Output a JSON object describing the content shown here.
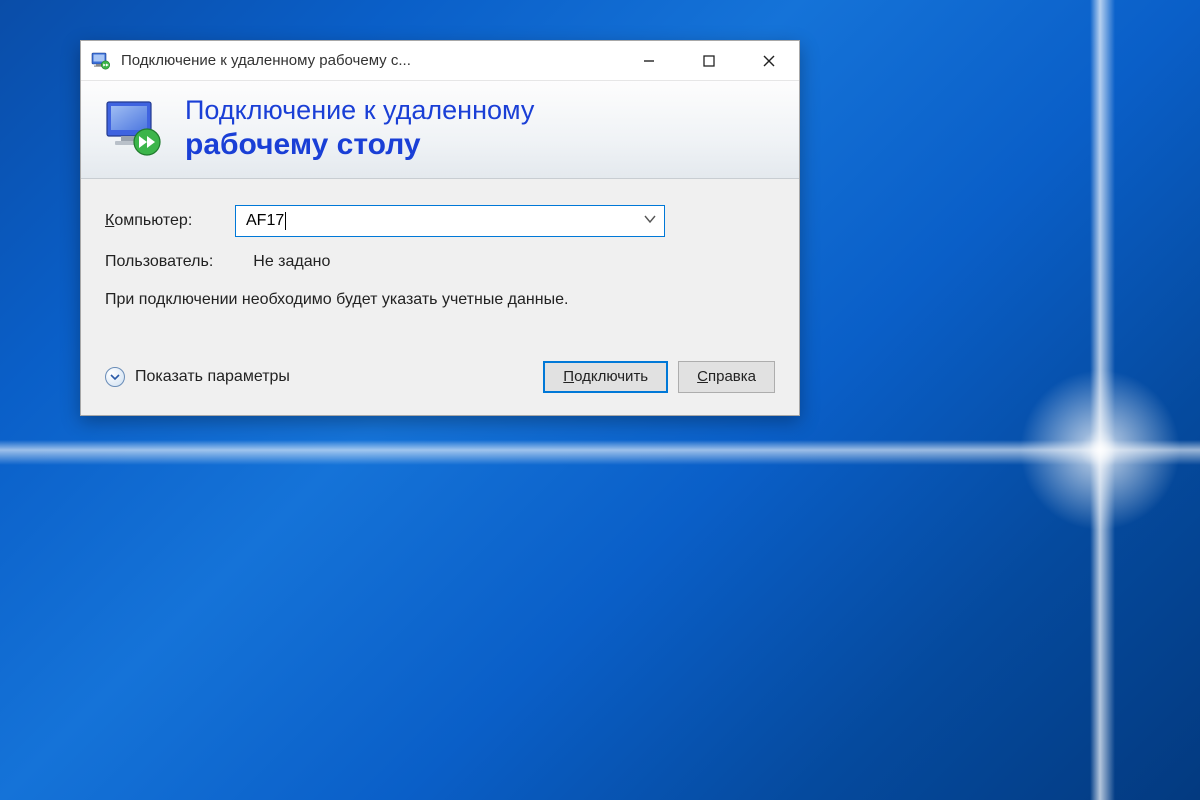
{
  "window": {
    "title": "Подключение к удаленному рабочему с..."
  },
  "banner": {
    "line1": "Подключение к удаленному",
    "line2": "рабочему столу"
  },
  "form": {
    "computer_label_head": "К",
    "computer_label_rest": "омпьютер:",
    "computer_value": "AF17",
    "user_label": "Пользователь:",
    "user_value": "Не задано",
    "info_text": "При подключении необходимо будет указать учетные данные."
  },
  "footer": {
    "show_options_head": "П",
    "show_options_rest": "оказать параметры",
    "connect_head": "П",
    "connect_rest": "одключить",
    "help_head": "С",
    "help_rest": "правка"
  }
}
